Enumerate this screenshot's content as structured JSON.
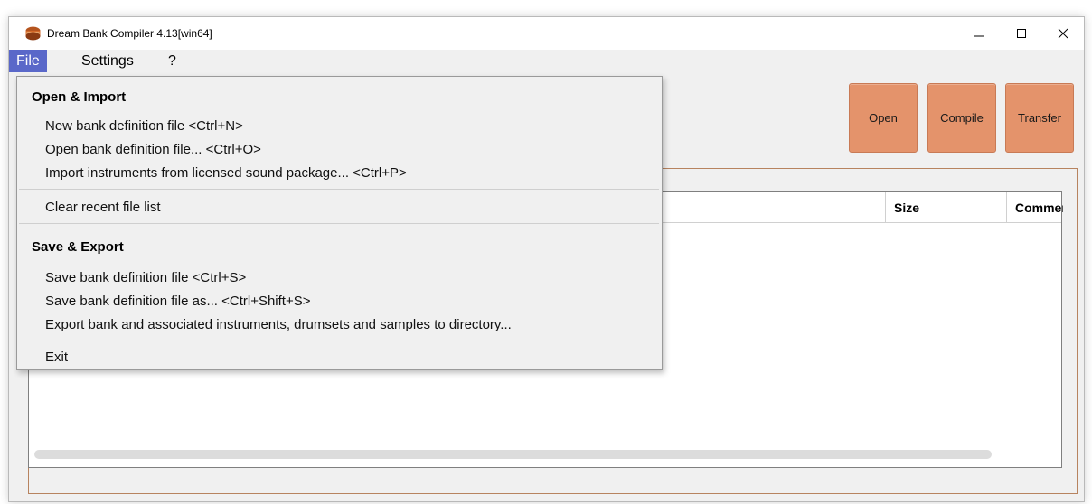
{
  "window": {
    "title": "Dream Bank Compiler 4.13[win64]",
    "icon": "app-icon"
  },
  "menubar": {
    "items": [
      {
        "label": "File",
        "active": true
      },
      {
        "label": "Settings",
        "active": false
      },
      {
        "label": "?",
        "active": false
      }
    ]
  },
  "toolbar": {
    "open_label": "Open",
    "compile_label": "Compile",
    "transfer_label": "Transfer",
    "button_color": "#e4936b"
  },
  "table": {
    "columns": [
      "Size",
      "Commen"
    ]
  },
  "file_menu": {
    "section_open_import": "Open & Import",
    "new_bank": "New bank definition file <Ctrl+N>",
    "open_bank": "Open bank definition file... <Ctrl+O>",
    "import_instruments": "Import instruments from licensed sound package... <Ctrl+P>",
    "clear_recent": "Clear recent file list",
    "section_save_export": "Save & Export",
    "save_bank": "Save bank definition file <Ctrl+S>",
    "save_bank_as": "Save bank definition file as... <Ctrl+Shift+S>",
    "export_bank": "Export bank and associated instruments, drumsets and samples to directory...",
    "exit": "Exit"
  },
  "colors": {
    "menu_active": "#5a68c9",
    "frame_accent": "#b7835f"
  }
}
